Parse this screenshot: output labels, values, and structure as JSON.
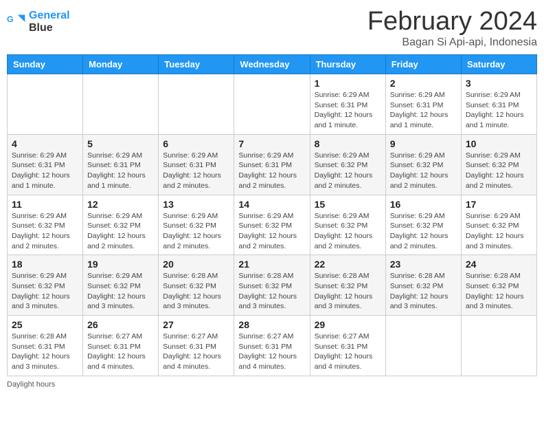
{
  "logo": {
    "line1": "General",
    "line2": "Blue"
  },
  "header": {
    "month": "February 2024",
    "location": "Bagan Si Api-api, Indonesia"
  },
  "days_of_week": [
    "Sunday",
    "Monday",
    "Tuesday",
    "Wednesday",
    "Thursday",
    "Friday",
    "Saturday"
  ],
  "weeks": [
    [
      {
        "num": "",
        "info": ""
      },
      {
        "num": "",
        "info": ""
      },
      {
        "num": "",
        "info": ""
      },
      {
        "num": "",
        "info": ""
      },
      {
        "num": "1",
        "info": "Sunrise: 6:29 AM\nSunset: 6:31 PM\nDaylight: 12 hours and 1 minute."
      },
      {
        "num": "2",
        "info": "Sunrise: 6:29 AM\nSunset: 6:31 PM\nDaylight: 12 hours and 1 minute."
      },
      {
        "num": "3",
        "info": "Sunrise: 6:29 AM\nSunset: 6:31 PM\nDaylight: 12 hours and 1 minute."
      }
    ],
    [
      {
        "num": "4",
        "info": "Sunrise: 6:29 AM\nSunset: 6:31 PM\nDaylight: 12 hours and 1 minute."
      },
      {
        "num": "5",
        "info": "Sunrise: 6:29 AM\nSunset: 6:31 PM\nDaylight: 12 hours and 1 minute."
      },
      {
        "num": "6",
        "info": "Sunrise: 6:29 AM\nSunset: 6:31 PM\nDaylight: 12 hours and 2 minutes."
      },
      {
        "num": "7",
        "info": "Sunrise: 6:29 AM\nSunset: 6:31 PM\nDaylight: 12 hours and 2 minutes."
      },
      {
        "num": "8",
        "info": "Sunrise: 6:29 AM\nSunset: 6:32 PM\nDaylight: 12 hours and 2 minutes."
      },
      {
        "num": "9",
        "info": "Sunrise: 6:29 AM\nSunset: 6:32 PM\nDaylight: 12 hours and 2 minutes."
      },
      {
        "num": "10",
        "info": "Sunrise: 6:29 AM\nSunset: 6:32 PM\nDaylight: 12 hours and 2 minutes."
      }
    ],
    [
      {
        "num": "11",
        "info": "Sunrise: 6:29 AM\nSunset: 6:32 PM\nDaylight: 12 hours and 2 minutes."
      },
      {
        "num": "12",
        "info": "Sunrise: 6:29 AM\nSunset: 6:32 PM\nDaylight: 12 hours and 2 minutes."
      },
      {
        "num": "13",
        "info": "Sunrise: 6:29 AM\nSunset: 6:32 PM\nDaylight: 12 hours and 2 minutes."
      },
      {
        "num": "14",
        "info": "Sunrise: 6:29 AM\nSunset: 6:32 PM\nDaylight: 12 hours and 2 minutes."
      },
      {
        "num": "15",
        "info": "Sunrise: 6:29 AM\nSunset: 6:32 PM\nDaylight: 12 hours and 2 minutes."
      },
      {
        "num": "16",
        "info": "Sunrise: 6:29 AM\nSunset: 6:32 PM\nDaylight: 12 hours and 2 minutes."
      },
      {
        "num": "17",
        "info": "Sunrise: 6:29 AM\nSunset: 6:32 PM\nDaylight: 12 hours and 3 minutes."
      }
    ],
    [
      {
        "num": "18",
        "info": "Sunrise: 6:29 AM\nSunset: 6:32 PM\nDaylight: 12 hours and 3 minutes."
      },
      {
        "num": "19",
        "info": "Sunrise: 6:29 AM\nSunset: 6:32 PM\nDaylight: 12 hours and 3 minutes."
      },
      {
        "num": "20",
        "info": "Sunrise: 6:28 AM\nSunset: 6:32 PM\nDaylight: 12 hours and 3 minutes."
      },
      {
        "num": "21",
        "info": "Sunrise: 6:28 AM\nSunset: 6:32 PM\nDaylight: 12 hours and 3 minutes."
      },
      {
        "num": "22",
        "info": "Sunrise: 6:28 AM\nSunset: 6:32 PM\nDaylight: 12 hours and 3 minutes."
      },
      {
        "num": "23",
        "info": "Sunrise: 6:28 AM\nSunset: 6:32 PM\nDaylight: 12 hours and 3 minutes."
      },
      {
        "num": "24",
        "info": "Sunrise: 6:28 AM\nSunset: 6:32 PM\nDaylight: 12 hours and 3 minutes."
      }
    ],
    [
      {
        "num": "25",
        "info": "Sunrise: 6:28 AM\nSunset: 6:31 PM\nDaylight: 12 hours and 3 minutes."
      },
      {
        "num": "26",
        "info": "Sunrise: 6:27 AM\nSunset: 6:31 PM\nDaylight: 12 hours and 4 minutes."
      },
      {
        "num": "27",
        "info": "Sunrise: 6:27 AM\nSunset: 6:31 PM\nDaylight: 12 hours and 4 minutes."
      },
      {
        "num": "28",
        "info": "Sunrise: 6:27 AM\nSunset: 6:31 PM\nDaylight: 12 hours and 4 minutes."
      },
      {
        "num": "29",
        "info": "Sunrise: 6:27 AM\nSunset: 6:31 PM\nDaylight: 12 hours and 4 minutes."
      },
      {
        "num": "",
        "info": ""
      },
      {
        "num": "",
        "info": ""
      }
    ]
  ],
  "footer": {
    "note": "Daylight hours"
  }
}
